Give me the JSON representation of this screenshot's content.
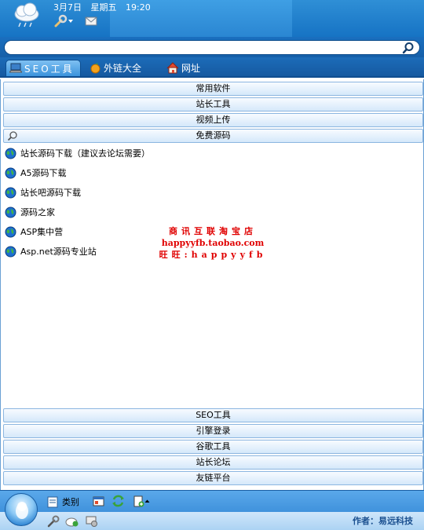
{
  "header": {
    "date": "3月7日",
    "weekday": "星期五",
    "time": "19:20"
  },
  "search": {
    "placeholder": "",
    "value": ""
  },
  "tabs": [
    {
      "label": "SEO工具"
    },
    {
      "label": "外链大全"
    },
    {
      "label": "网址"
    }
  ],
  "categories_top": [
    {
      "label": "常用软件"
    },
    {
      "label": "站长工具"
    },
    {
      "label": "视频上传"
    },
    {
      "label": "免费源码"
    }
  ],
  "links": [
    {
      "label": "站长源码下载（建议去论坛需要）"
    },
    {
      "label": "A5源码下载"
    },
    {
      "label": "站长吧源码下载"
    },
    {
      "label": "源码之家"
    },
    {
      "label": "ASP集中营"
    },
    {
      "label": "Asp.net源码专业站"
    }
  ],
  "promo": {
    "line1": "商讯互联淘宝店",
    "line2": "happyyfb.taobao.com",
    "line3": "旺旺:happyyfb"
  },
  "categories_bottom": [
    {
      "label": "SEO工具"
    },
    {
      "label": "引擎登录"
    },
    {
      "label": "谷歌工具"
    },
    {
      "label": "站长论坛"
    },
    {
      "label": "友链平台"
    }
  ],
  "footer": {
    "category_label": "类别",
    "author": "作者：易远科技"
  },
  "colors": {
    "header_blue": "#1673c4",
    "category_border": "#8cb6e0",
    "promo_red": "#e00000",
    "author_blue": "#1a4f8f"
  }
}
